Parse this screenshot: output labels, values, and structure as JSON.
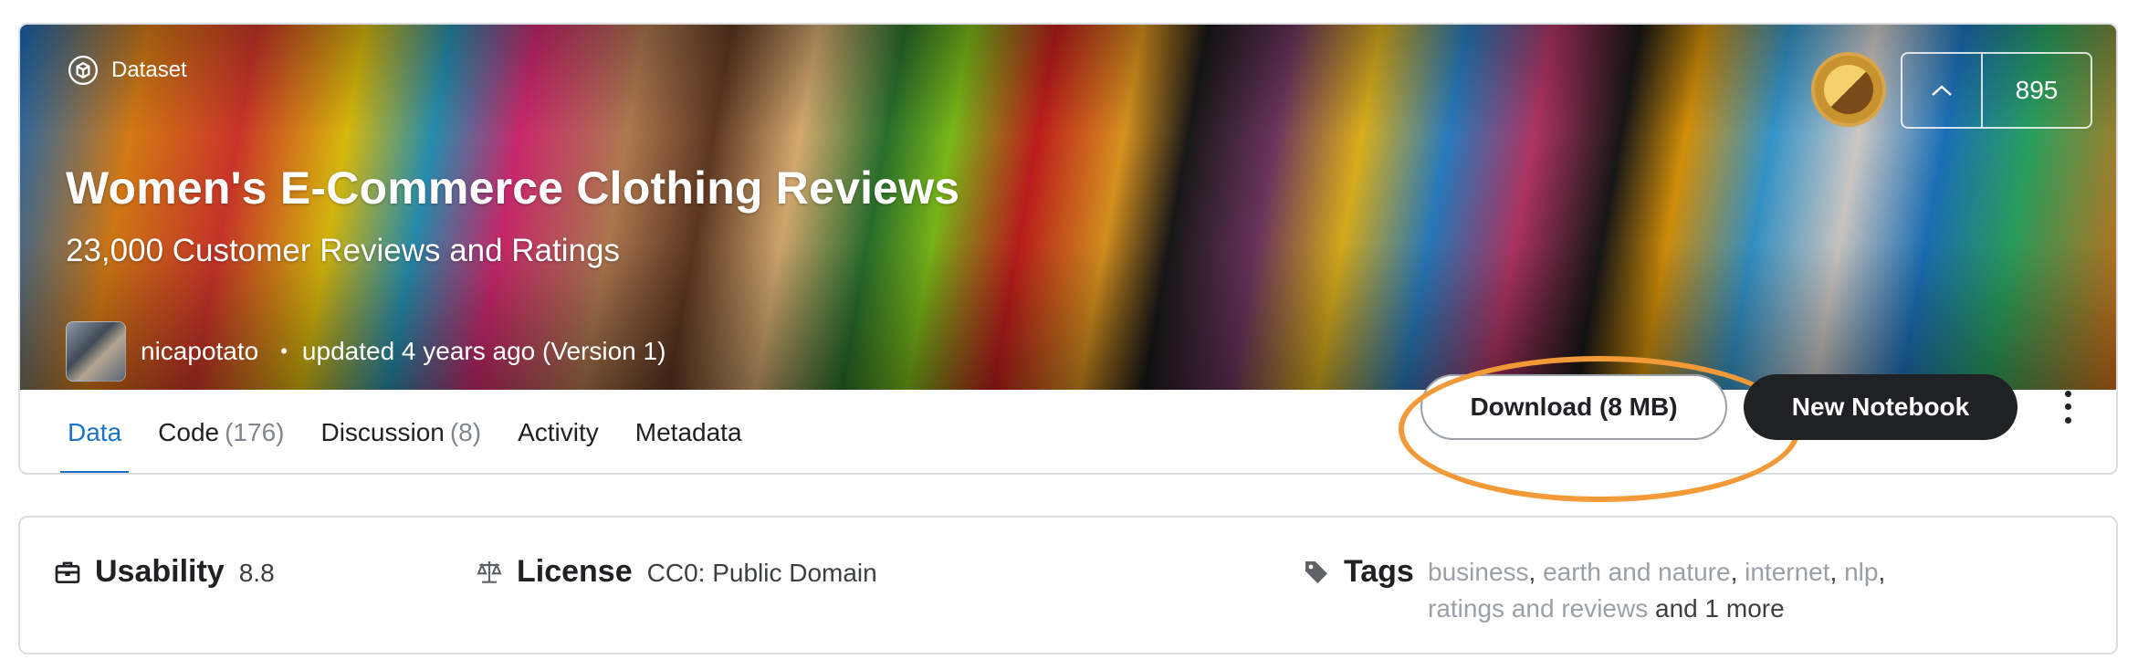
{
  "header": {
    "type_label": "Dataset",
    "title": "Women's E-Commerce Clothing Reviews",
    "subtitle": "23,000 Customer Reviews and Ratings",
    "author": "nicapotato",
    "updated": "updated 4 years ago (Version 1)",
    "upvotes": "895"
  },
  "tabs": [
    {
      "label": "Data",
      "count": ""
    },
    {
      "label": "Code",
      "count": "(176)"
    },
    {
      "label": "Discussion",
      "count": "(8)"
    },
    {
      "label": "Activity",
      "count": ""
    },
    {
      "label": "Metadata",
      "count": ""
    }
  ],
  "actions": {
    "download_label": "Download (8 MB)",
    "new_notebook_label": "New Notebook"
  },
  "meta": {
    "usability_label": "Usability",
    "usability_value": "8.8",
    "license_label": "License",
    "license_value": "CC0: Public Domain",
    "tags_label": "Tags",
    "tags": [
      "business",
      "earth and nature",
      "internet",
      "nlp",
      "ratings and reviews"
    ],
    "tags_more": "and 1 more"
  },
  "colors": {
    "accent": "#1a73c8",
    "highlight": "#f29a38",
    "primary_button": "#202124"
  },
  "icons": {
    "dataset": "dataset-icon",
    "upvote": "chevron-up-icon",
    "usability": "briefcase-icon",
    "license": "scales-icon",
    "tags": "tag-icon",
    "more": "kebab-menu-icon"
  }
}
